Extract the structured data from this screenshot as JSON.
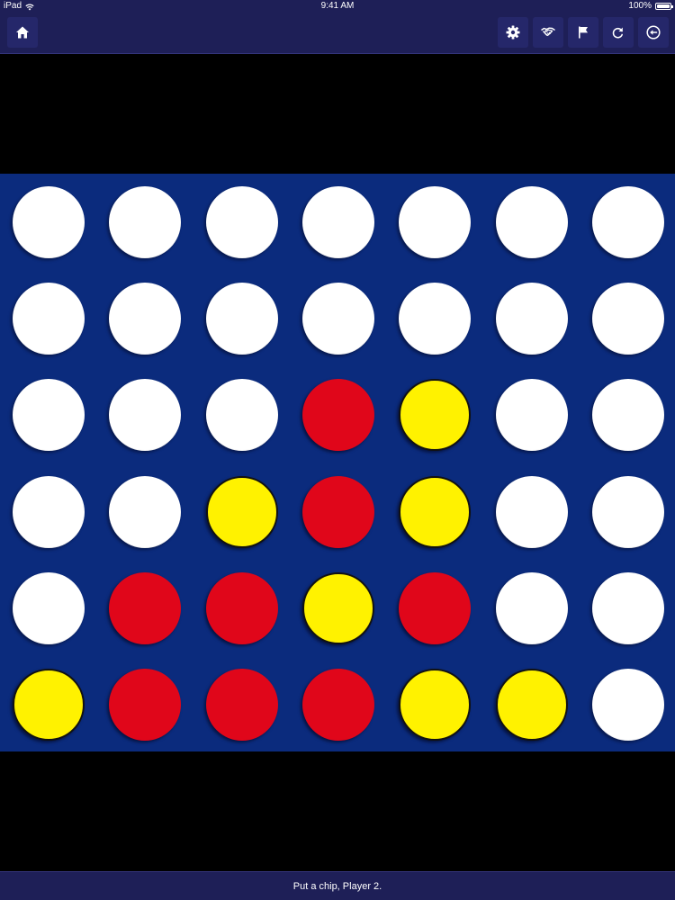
{
  "status_bar": {
    "carrier": "iPad",
    "time": "9:41 AM",
    "battery": "100%"
  },
  "toolbar": {
    "home_icon": "home-icon",
    "right_icons": [
      "gear-icon",
      "handshake-icon",
      "flag-icon",
      "redo-icon",
      "back-circle-icon"
    ]
  },
  "game": {
    "columns": 7,
    "rows": 6,
    "colors": {
      "board": "#0b2b7d",
      "empty": "#ffffff",
      "red": "#e0061a",
      "yellow": "#fff200",
      "bar": "#1e1f57"
    },
    "grid": [
      [
        "empty",
        "empty",
        "empty",
        "empty",
        "empty",
        "empty",
        "empty"
      ],
      [
        "empty",
        "empty",
        "empty",
        "empty",
        "empty",
        "empty",
        "empty"
      ],
      [
        "empty",
        "empty",
        "empty",
        "red",
        "yellow",
        "empty",
        "empty"
      ],
      [
        "empty",
        "empty",
        "yellow",
        "red",
        "yellow",
        "empty",
        "empty"
      ],
      [
        "empty",
        "red",
        "red",
        "yellow",
        "red",
        "empty",
        "empty"
      ],
      [
        "yellow",
        "red",
        "red",
        "red",
        "yellow",
        "yellow",
        "empty"
      ]
    ]
  },
  "status_message": "Put a chip, Player 2."
}
